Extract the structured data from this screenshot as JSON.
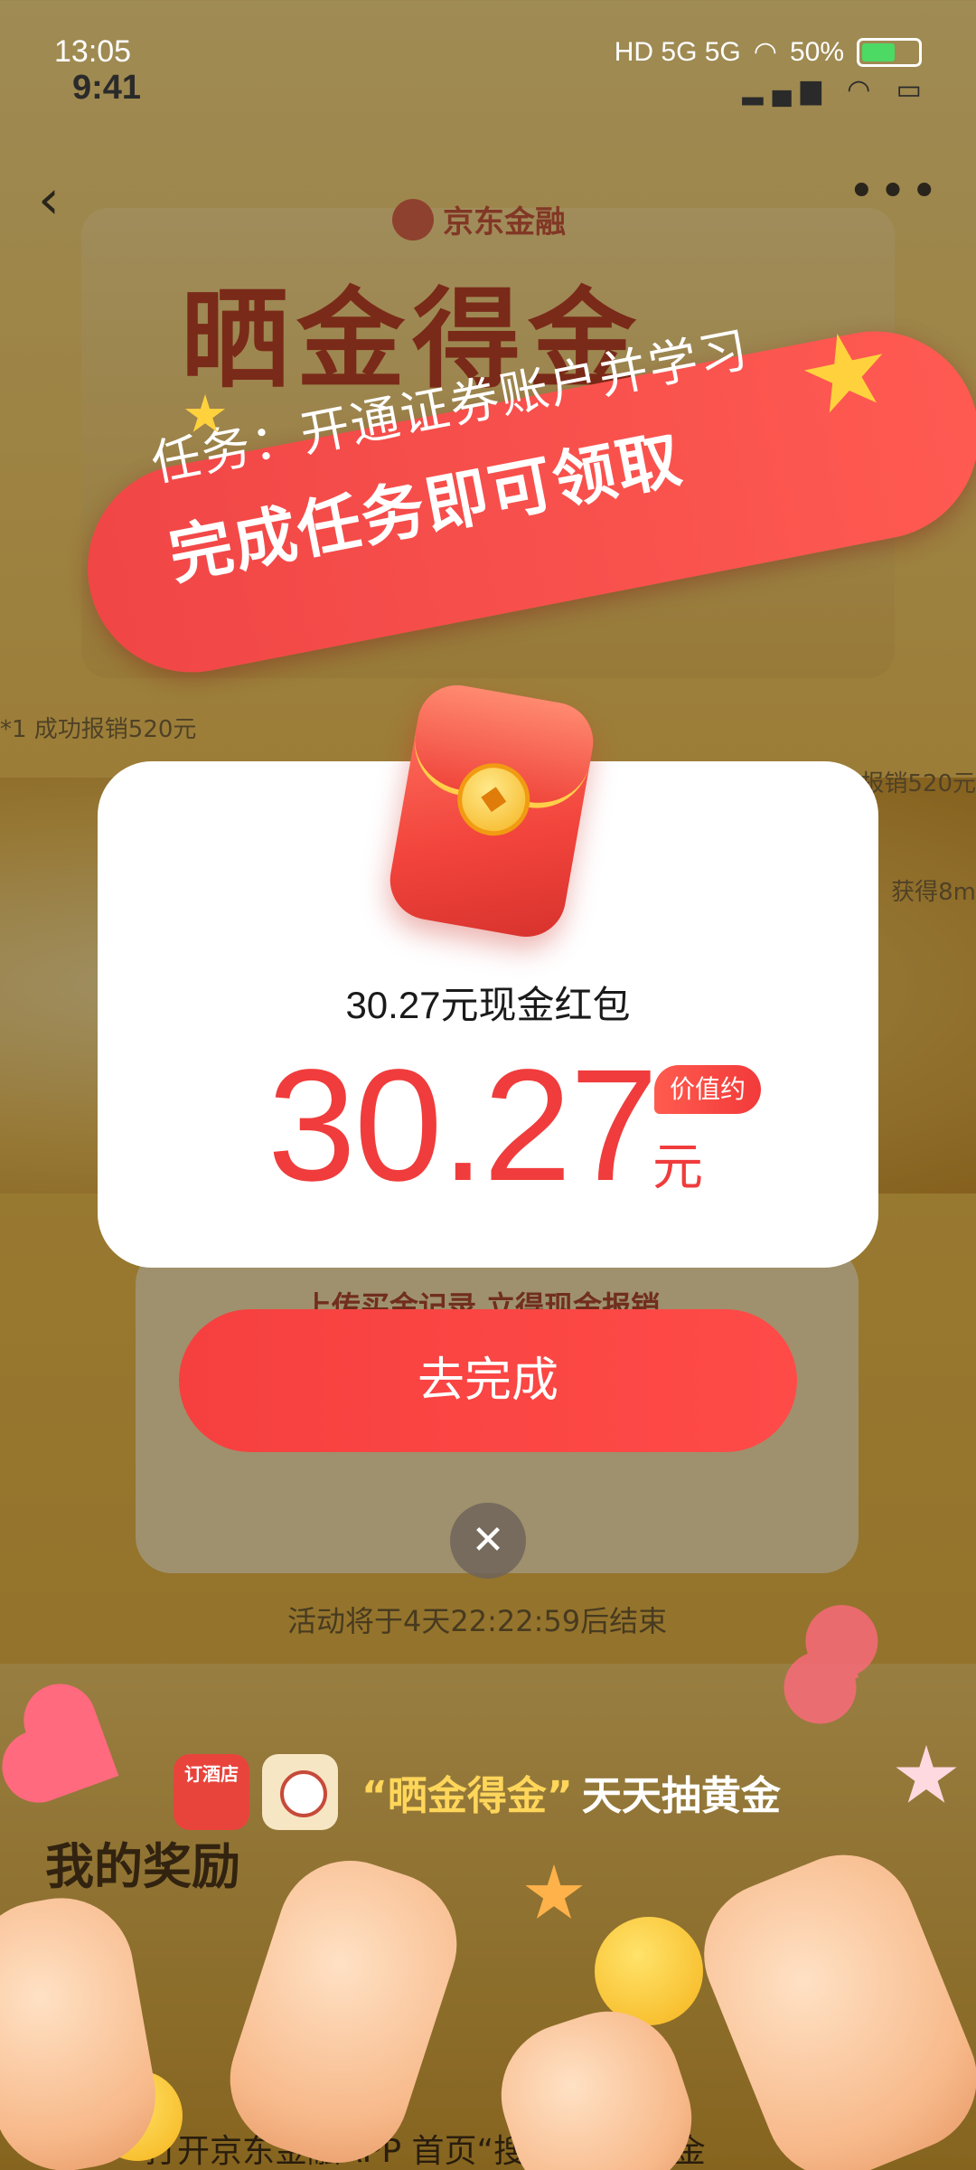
{
  "status_bar": {
    "time": "13:05",
    "time_secondary": "9:41",
    "network": "HD 5G 5G",
    "battery_percent": "50%"
  },
  "nav": {
    "back_icon": "chevron-left-icon",
    "more_icon": "more-dots-icon",
    "brand": "京东金融",
    "hero_title": "晒金得金"
  },
  "background": {
    "caption_left": "*1 成功报销520元",
    "caption_right": "报销520元",
    "caption_right2": "获得8m",
    "upload_text": "上传买金记录 立得现金报销",
    "countdown": "活动将于4天22:22:59后结束",
    "my_reward": "我的奖励",
    "bottom_hint": "打开京东金融APP 首页“搜索”晒金得金"
  },
  "ribbon": {
    "line1": "任务：开通证券账户并学习",
    "line2": "完成任务即可领取"
  },
  "popup": {
    "subtitle": "30.27元现金红包",
    "amount": "30.27",
    "badge": "价值约",
    "unit": "元",
    "button_label": "去完成",
    "close_icon": "close-icon"
  },
  "promo": {
    "app1_label": "订酒店",
    "quote": "“晒金得金”",
    "text": "天天抽黄金"
  },
  "colors": {
    "accent_red": "#f03c3c",
    "ribbon_red": "#ff5a52",
    "gold": "#efc25a"
  }
}
